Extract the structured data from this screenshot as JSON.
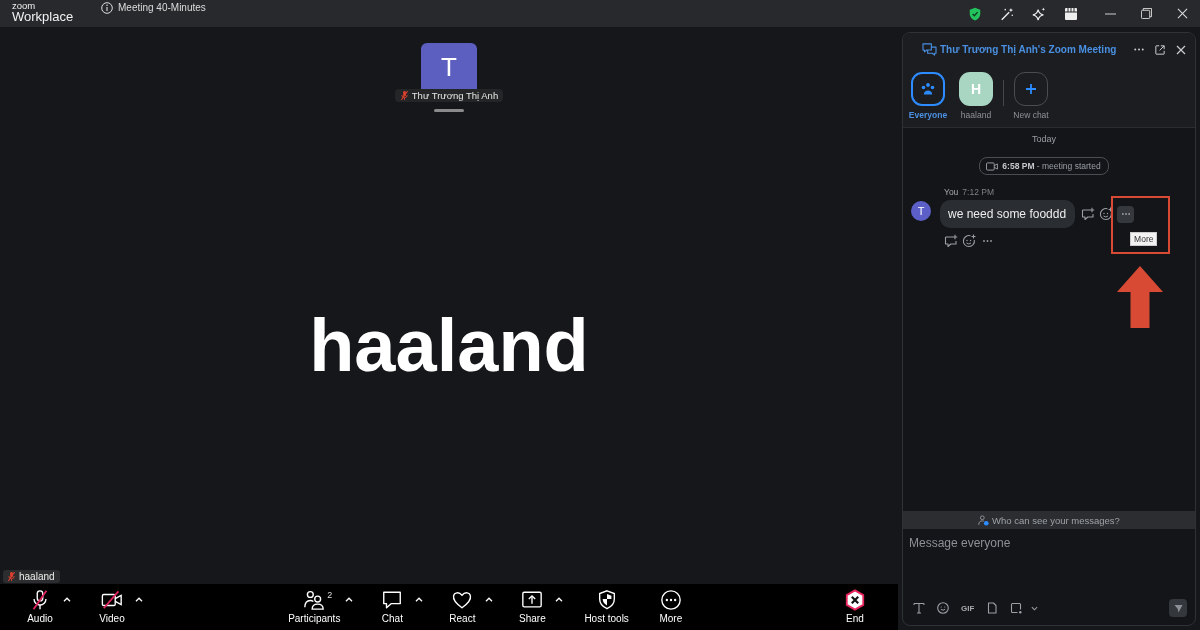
{
  "title_bar": {
    "logo": {
      "top": "zoom",
      "bottom": "Workplace"
    },
    "meeting_info": "Meeting 40-Minutes"
  },
  "video": {
    "tile": {
      "initial": "T",
      "name": "Thư Trương Thị Anh",
      "muted": true
    },
    "active_speaker": "haaland",
    "self_view_tag": {
      "name": "haaland",
      "muted": true
    }
  },
  "toolbar": {
    "left": [
      {
        "kind": "audio",
        "label": "Audio",
        "off": true,
        "has_menu": true
      },
      {
        "kind": "video",
        "label": "Video",
        "off": true,
        "has_menu": true
      }
    ],
    "center": [
      {
        "kind": "participants",
        "label": "Participants",
        "count": "2",
        "has_menu": true
      },
      {
        "kind": "chat",
        "label": "Chat",
        "has_menu": true
      },
      {
        "kind": "react",
        "label": "React",
        "has_menu": true
      },
      {
        "kind": "share",
        "label": "Share",
        "has_menu": true
      },
      {
        "kind": "host_tools",
        "label": "Host tools",
        "has_menu": false
      },
      {
        "kind": "more",
        "label": "More",
        "has_menu": false
      }
    ],
    "right": [
      {
        "kind": "end",
        "label": "End",
        "has_menu": false
      }
    ]
  },
  "chat_panel": {
    "title": "Thư Trương Thị Anh's Zoom Meeting",
    "recipients": [
      {
        "kind": "everyone",
        "label": "Everyone",
        "selected": true
      },
      {
        "kind": "contact",
        "initial": "H",
        "label": "haaland",
        "selected": false
      },
      {
        "kind": "new",
        "label": "New chat",
        "selected": false
      }
    ],
    "date_divider": "Today",
    "event": "**6:58 PM** - meeting started",
    "messages": [
      {
        "sender": "You",
        "time": "7:12 PM",
        "avatar_initial": "T",
        "text": "we need some fooddd",
        "tooltip": "More"
      }
    ],
    "visibility_notice": "Who can see your messages?",
    "composer": {
      "placeholder": "Message everyone",
      "gif_label": "GIF"
    }
  }
}
